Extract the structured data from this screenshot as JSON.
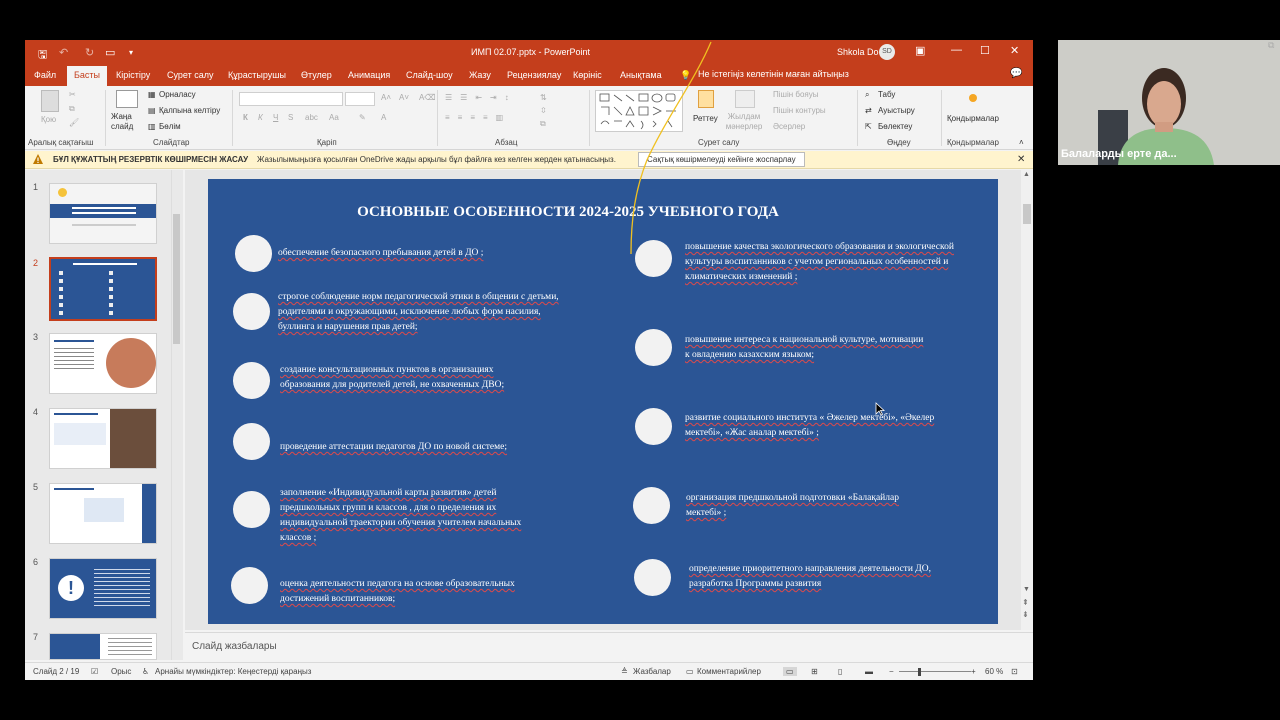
{
  "window": {
    "title": "ИМП 02.07.pptx - PowerPoint",
    "user_name": "Shkola Do",
    "user_initials": "SD"
  },
  "tabs": [
    "Файл",
    "Басты",
    "Кірістіру",
    "Сурет салу",
    "Құрастырушы",
    "Өтулер",
    "Анимация",
    "Слайд-шоу",
    "Жазу",
    "Рецензиялау",
    "Көрініс",
    "Анықтама"
  ],
  "tell_me": "Не істегіңіз келетінін маған айтыңыз",
  "ribbon": {
    "clipboard": {
      "paste": "Қою",
      "label": "Аралық сақтағыш"
    },
    "slides": {
      "new_slide": "Жаңа слайд",
      "layout": "Орналасу",
      "reset": "Қалпына келтіру",
      "section": "Бөлім",
      "label": "Слайдтар"
    },
    "font": {
      "bold": "К",
      "italic": "К",
      "underline": "Ч",
      "strike": "S",
      "label": "Қаріп"
    },
    "paragraph": {
      "label": "Абзац"
    },
    "drawing": {
      "arrange": "Реттеу",
      "quick_styles": "Жылдам мәнерлер",
      "fill": "Пішін бояуы",
      "outline": "Пішін контуры",
      "effects": "Әсерлер",
      "label": "Сурет салу"
    },
    "editing": {
      "find": "Табу",
      "replace": "Ауыстыру",
      "select": "Бөлектеу",
      "label": "Өңдеу"
    },
    "addins": {
      "name": "Қондырмалар",
      "label": "Қондырмалар"
    }
  },
  "infobar": {
    "title": "БҰЛ ҚҰЖАТТЫҢ РЕЗЕРВТІК КӨШІРМЕСІН ЖАСАУ",
    "message": "Жазылымыңызға қосылған OneDrive жады арқылы бұл файлға кез келген жерден қатынасыңыз.",
    "button": "Сақтық көшірмелеуді кейінге жоспарлау"
  },
  "thumbnails": [
    "1",
    "2",
    "3",
    "4",
    "5",
    "6",
    "7"
  ],
  "slide": {
    "title": "ОСНОВНЫЕ ОСОБЕННОСТИ 2024-2025 УЧЕБНОГО ГОДА",
    "left_items": [
      "обеспечение безопасного пребывания детей в ДО ;",
      "строгое соблюдение норм педагогической этики в общении с детьми, родителями и окружающими, исключение любых форм насилия, буллинга и нарушения прав детей;",
      "создание консультационных пунктов в организациях образования для родителей детей, не охваченных ДВО;",
      "проведение аттестации педагогов ДО по новой системе;",
      "заполнение «Индивидуальной карты развития» детей предшкольных групп и классов , для о пределения их индивидуальной траектории обучения учителем начальных классов ;",
      "оценка деятельности педагога на основе образовательных достижений воспитанников;"
    ],
    "right_items": [
      "повышение качества экологического образования и экологической культуры воспитанников с учетом региональных особенностей и климатических изменений ;",
      "повышение интереса к национальной культуре, мотивации к овладению казахским языком;",
      "развитие социального института « Әжелер мектебі», «Әкелер мектебі», «Жас аналар мектебі» ;",
      "организация предшкольной подготовки «Балақайлар мектебі» ;",
      "определение приоритетного направления деятельности ДО, разработка Программы развития"
    ]
  },
  "notes_placeholder": "Слайд жазбалары",
  "statusbar": {
    "slide_counter": "Слайд 2 / 19",
    "language": "Орыс",
    "accessibility": "Арнайы мүмкіндіктер: Кеңестерді қараңыз",
    "notes": "Жазбалар",
    "comments": "Комментарийлер",
    "zoom": "60 %"
  },
  "webcam": {
    "name": "Балаларды ерте да..."
  },
  "colors": {
    "accent": "#c43e1c",
    "slide_bg": "#2b5595",
    "infobar_bg": "#fff4ce"
  }
}
